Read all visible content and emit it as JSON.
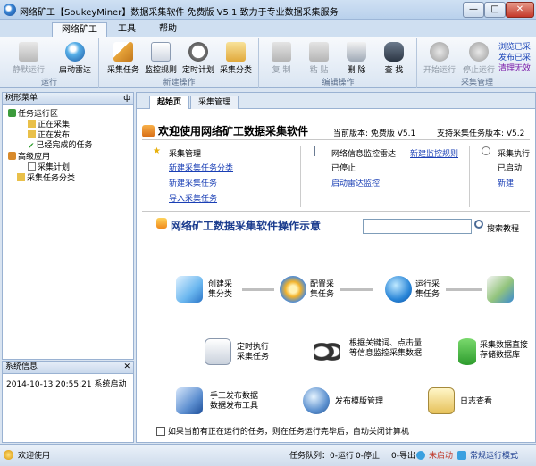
{
  "window": {
    "title": "网络矿工【SoukeyMiner】数据采集软件 免费版 V5.1 致力于专业数据采集服务",
    "min": "—",
    "max": "□",
    "close": "✕"
  },
  "menu": {
    "tabs": [
      "网络矿工",
      "工具",
      "帮助"
    ]
  },
  "ribbon": {
    "groups": [
      {
        "label": "运行"
      },
      {
        "label": "新建操作"
      },
      {
        "label": "编辑操作"
      },
      {
        "label": "采集管理"
      }
    ],
    "buttons": [
      {
        "label": "静默运行",
        "icon": "silent-run-icon",
        "disabled": true
      },
      {
        "label": "启动雷达",
        "icon": "radar-icon",
        "disabled": false
      },
      {
        "label": "采集任务",
        "icon": "new-task-icon",
        "disabled": false
      },
      {
        "label": "监控规则",
        "icon": "monitor-rule-icon",
        "disabled": false
      },
      {
        "label": "定时计划",
        "icon": "clock-icon",
        "disabled": false
      },
      {
        "label": "采集分类",
        "icon": "category-icon",
        "disabled": false
      },
      {
        "label": "复 制",
        "icon": "copy-icon",
        "disabled": true
      },
      {
        "label": "粘 贴",
        "icon": "paste-icon",
        "disabled": true
      },
      {
        "label": "删 除",
        "icon": "delete-icon",
        "disabled": false
      },
      {
        "label": "查 找",
        "icon": "find-icon",
        "disabled": false
      },
      {
        "label": "开始运行",
        "icon": "start-icon",
        "disabled": true
      },
      {
        "label": "停止运行",
        "icon": "stop-icon",
        "disabled": true
      }
    ],
    "extra": [
      {
        "label": "浏览已采",
        "color": "#1b45b8"
      },
      {
        "label": "发布已采",
        "color": "#1b45b8"
      },
      {
        "label": "清理无效",
        "color": "#7a1aa8"
      }
    ]
  },
  "sidebar": {
    "title": "树形菜单",
    "pin": "ф",
    "tree": [
      {
        "label": "任务运行区",
        "level": 0,
        "icon": "run-area-icon"
      },
      {
        "label": "正在采集",
        "level": 1,
        "icon": "collecting-icon"
      },
      {
        "label": "正在发布",
        "level": 1,
        "icon": "publishing-icon"
      },
      {
        "label": "已经完成的任务",
        "level": 1,
        "icon": "done-icon"
      },
      {
        "label": "高级应用",
        "level": 0,
        "icon": "advanced-icon"
      },
      {
        "label": "采集计划",
        "level": 1,
        "icon": "plan-icon"
      },
      {
        "label": "采集任务分类",
        "level": 0,
        "icon": "task-category-icon"
      }
    ]
  },
  "sysinfo": {
    "title": "系统信息",
    "close": "✕",
    "log": "2014-10-13 20:55:21 系统启动"
  },
  "doc_tabs": [
    "起始页",
    "采集管理"
  ],
  "start": {
    "welcome": "欢迎使用网络矿工数据采集软件",
    "version_label": "当前版本: 免费版 V5.1",
    "support_label": "支持采集任务版本: V5.2",
    "sections": [
      {
        "title": "采集管理",
        "links": [
          "新建采集任务分类",
          "新建采集任务",
          "导入采集任务"
        ]
      },
      {
        "title": "网络信息监控雷达",
        "status": "已停止",
        "links": [
          "新建监控规则",
          "启动雷达监控"
        ]
      },
      {
        "title": "采集执行",
        "status": "已启动",
        "links": [
          "新建"
        ]
      }
    ],
    "diagram_title": "网络矿工数据采集软件操作示意",
    "search_value": "",
    "search_label": "搜索教程",
    "flow": [
      {
        "label": "创建采\n集分类",
        "icon": "folder-icon"
      },
      {
        "label": "配置采\n集任务",
        "icon": "gear-icon"
      },
      {
        "label": "运行采\n集任务",
        "icon": "play-icon"
      },
      {
        "label": "定时执行\n采集任务",
        "icon": "timer-icon"
      },
      {
        "label": "根据关键词、点击量\n等信息监控采集数据",
        "icon": "eyes-icon"
      },
      {
        "label": "采集数据直接\n存储数据库",
        "icon": "database-icon"
      },
      {
        "label": "手工发布数据\n数据发布工具",
        "icon": "publish-tool-icon"
      },
      {
        "label": "发布模版管理",
        "icon": "template-icon"
      },
      {
        "label": "日志查看",
        "icon": "log-icon"
      }
    ],
    "shutdown_check": "如果当前有正在运行的任务，则在任务运行完毕后，自动关闭计算机"
  },
  "status": {
    "welcome": "欢迎使用",
    "queue": "任务队列：0-运行",
    "stop": "0-停止",
    "export": "0-导出",
    "radar": "未启动",
    "mode": "常规运行模式"
  }
}
